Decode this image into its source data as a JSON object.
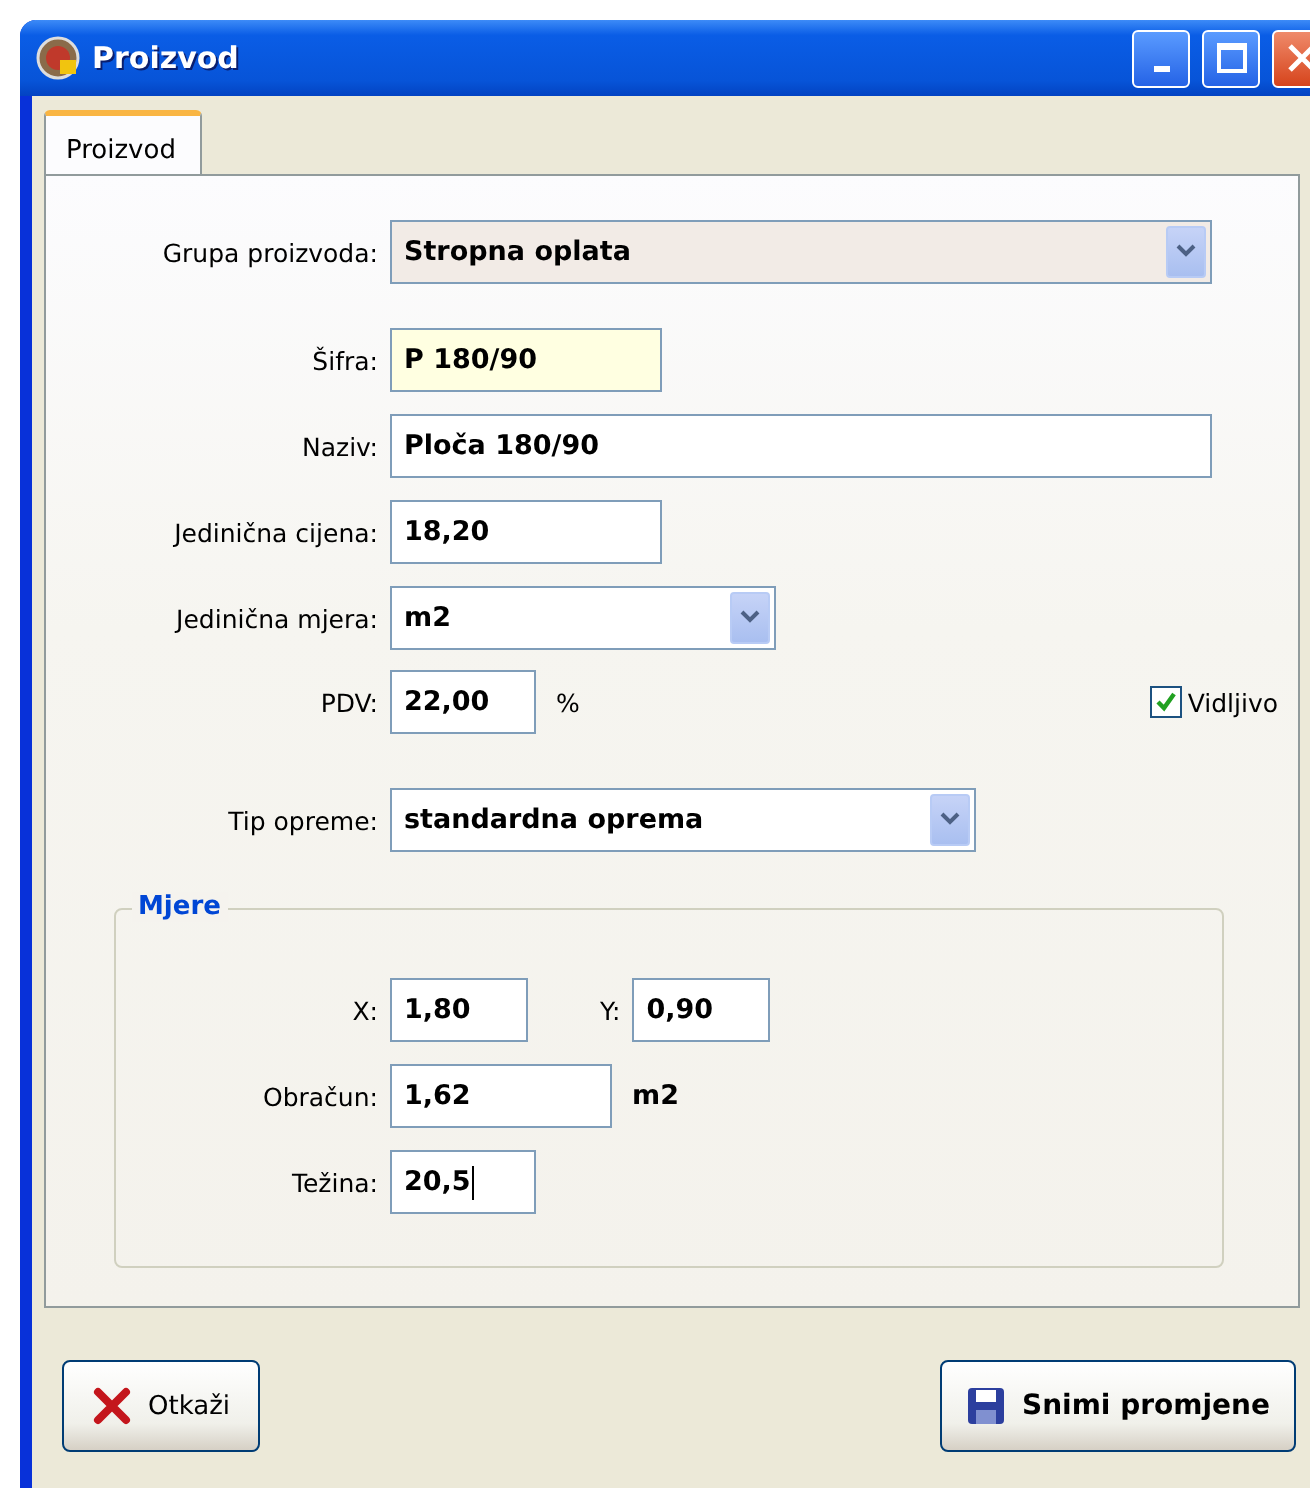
{
  "window": {
    "title": "Proizvod"
  },
  "tabs": [
    {
      "label": "Proizvod",
      "selected": true
    }
  ],
  "form": {
    "rows": [
      {
        "kind": "dropdown",
        "label": "Grupa proizvoda:",
        "value": "Stropna oplata",
        "highlighted": true
      },
      {
        "kind": "text",
        "label": "Šifra:",
        "value": "P 180/90",
        "highlighted": true
      },
      {
        "kind": "text",
        "label": "Naziv:",
        "value": "Ploča 180/90",
        "highlighted": false
      },
      {
        "kind": "text",
        "label": "Jedinična cijena:",
        "value": "18,20",
        "highlighted": false
      },
      {
        "kind": "dropdown",
        "label": "Jedinična mjera:",
        "value": "m2",
        "highlighted": false
      },
      {
        "kind": "text",
        "label": "PDV:",
        "value": "22,00",
        "highlighted": false,
        "unit": "%",
        "checkbox": {
          "label": "Vidljivo",
          "checked": true
        }
      },
      {
        "kind": "dropdown",
        "label": "Tip opreme:",
        "value": "standardna oprema",
        "highlighted": false
      }
    ]
  },
  "measures": {
    "title": "Mjere",
    "x": {
      "label": "X:",
      "value": "1,80"
    },
    "y": {
      "label": "Y:",
      "value": "0,90"
    },
    "calculation": {
      "label": "Obračun:",
      "value": "1,62",
      "unit": "m2"
    },
    "weight": {
      "label": "Težina:",
      "value": "20,5",
      "focused": true
    }
  },
  "buttons": [
    {
      "kind": "cancel",
      "label": "Otkaži"
    },
    {
      "kind": "save",
      "label": "Snimi promjene"
    }
  ]
}
